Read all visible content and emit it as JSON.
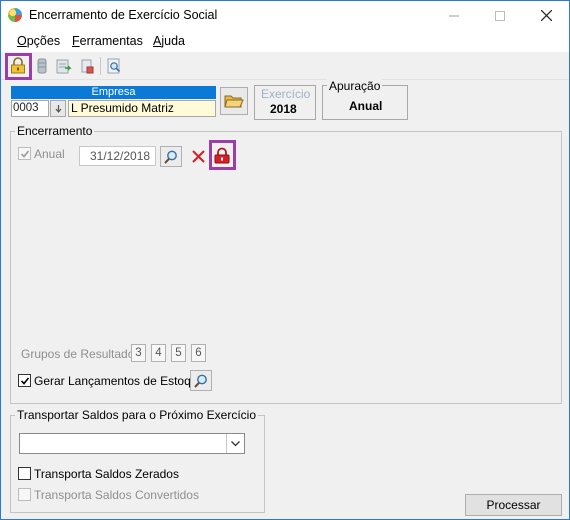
{
  "window": {
    "title": "Encerramento de Exercício Social",
    "icons": {
      "app": "app-logo-icon",
      "minimize": "minimize-icon",
      "maximize": "maximize-icon",
      "close": "close-icon"
    }
  },
  "menu": {
    "items": [
      {
        "first": "O",
        "rest": "pções"
      },
      {
        "first": "F",
        "rest": "erramentas"
      },
      {
        "first": "A",
        "rest": "juda"
      }
    ]
  },
  "toolbar": {
    "icons": [
      "lock-open-icon",
      "database-icon",
      "export-icon",
      "report-icon",
      "preview-icon"
    ]
  },
  "empresa": {
    "header": "Empresa",
    "code": "0003",
    "name": "L Presumido Matriz"
  },
  "exercicio": {
    "label": "Exercício",
    "value": "2018"
  },
  "apuracao": {
    "label": "Apuração",
    "value": "Anual"
  },
  "encerramento": {
    "title": "Encerramento",
    "anual_label": "Anual",
    "date": "31/12/2018",
    "grupos_label": "Grupos de Resultado:",
    "grupos": [
      "3",
      "4",
      "5",
      "6"
    ],
    "gerar_label": "Gerar Lançamentos de Estoque"
  },
  "transportar": {
    "title": "Transportar Saldos para o Próximo Exercício",
    "combo_value": "",
    "zerados_label": "Transporta Saldos Zerados",
    "convertidos_label": "Transporta Saldos Convertidos"
  },
  "actions": {
    "processar_label": "Processar"
  },
  "colors": {
    "accent_blue": "#0a7ad6",
    "highlight_purple": "#9a3fa8",
    "lock_red": "#d61f26",
    "field_yellow": "#fffbd9"
  }
}
